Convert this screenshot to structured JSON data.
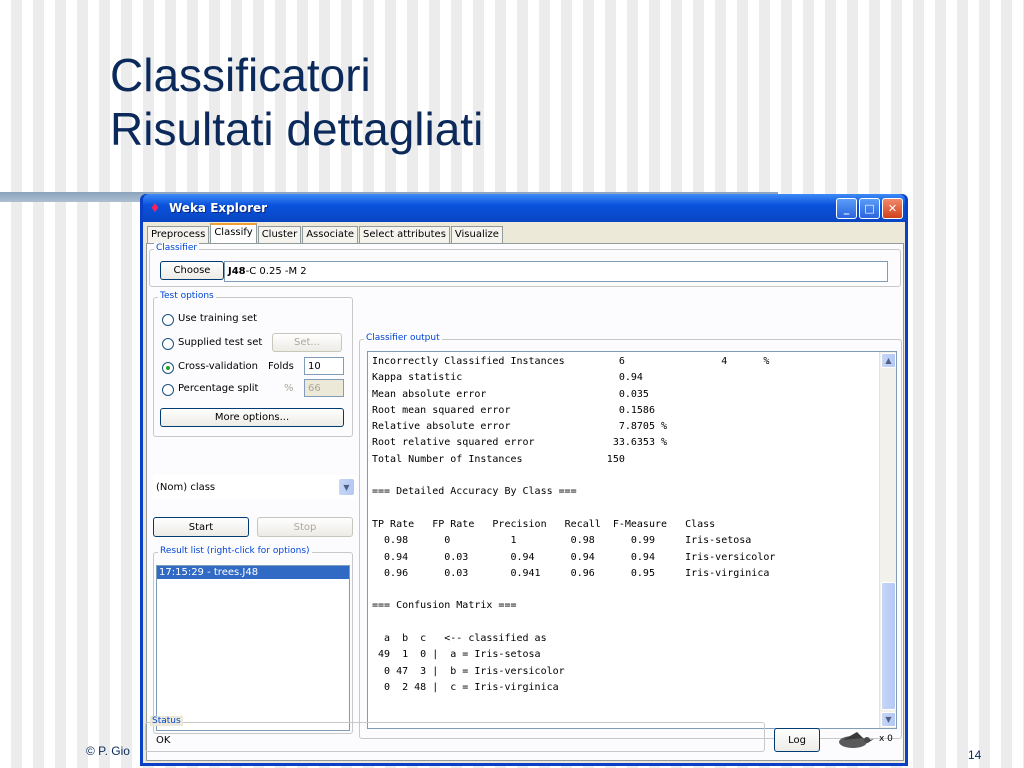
{
  "slide": {
    "title_line1": "Classificatori",
    "title_line2": "Risultati dettagliati",
    "footer_left": "© P. Gio",
    "page_number": "14"
  },
  "window": {
    "title": "Weka Explorer",
    "buttons": {
      "minimize": "_",
      "maximize": "□",
      "close": "✕"
    }
  },
  "tabs": [
    "Preprocess",
    "Classify",
    "Cluster",
    "Associate",
    "Select attributes",
    "Visualize"
  ],
  "active_tab": "Classify",
  "classifier": {
    "group_label": "Classifier",
    "choose_label": "Choose",
    "name": "J48",
    "options": " -C 0.25 -M 2"
  },
  "test_options": {
    "group_label": "Test options",
    "use_training_set": "Use training set",
    "supplied_test_set": "Supplied test set",
    "set_button": "Set...",
    "cross_validation": "Cross-validation",
    "folds_label": "Folds",
    "folds_value": "10",
    "percentage_split": "Percentage split",
    "percent_symbol": "%",
    "percent_value": "66",
    "more_options": "More options..."
  },
  "class_select": "(Nom) class",
  "start_label": "Start",
  "stop_label": "Stop",
  "result_list": {
    "group_label": "Result list (right-click for options)",
    "items": [
      "17:15:29 - trees.J48"
    ]
  },
  "output": {
    "group_label": "Classifier output",
    "lines": [
      "Incorrectly Classified Instances         6                4      %",
      "Kappa statistic                          0.94",
      "Mean absolute error                      0.035",
      "Root mean squared error                  0.1586",
      "Relative absolute error                  7.8705 %",
      "Root relative squared error             33.6353 %",
      "Total Number of Instances              150",
      "",
      "=== Detailed Accuracy By Class ===",
      "",
      "TP Rate   FP Rate   Precision   Recall  F-Measure   Class",
      "  0.98      0          1         0.98      0.99     Iris-setosa",
      "  0.94      0.03       0.94      0.94      0.94     Iris-versicolor",
      "  0.96      0.03       0.941     0.96      0.95     Iris-virginica",
      "",
      "=== Confusion Matrix ===",
      "",
      "  a  b  c   <-- classified as",
      " 49  1  0 |  a = Iris-setosa",
      "  0 47  3 |  b = Iris-versicolor",
      "  0  2 48 |  c = Iris-virginica"
    ]
  },
  "status": {
    "group_label": "Status",
    "text": "OK",
    "log_label": "Log",
    "count": "x 0"
  }
}
